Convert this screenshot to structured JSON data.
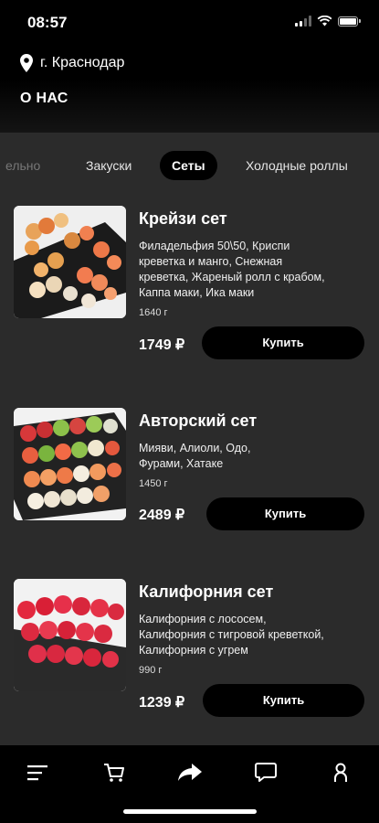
{
  "status": {
    "time": "08:57"
  },
  "header": {
    "city": "г. Краснодар",
    "about": "О НАС"
  },
  "tabs": [
    {
      "label": "ельно",
      "active": false
    },
    {
      "label": "Закуски",
      "active": false
    },
    {
      "label": "Сеты",
      "active": true
    },
    {
      "label": "Холодные роллы",
      "active": false
    }
  ],
  "products": [
    {
      "title": "Крейзи сет",
      "desc_lines": [
        "Филадельфия 50\\50, Криспи",
        "креветка и манго, Снежная",
        "креветка, Жареный ролл с крабом,",
        "Каппа маки, Ика маки"
      ],
      "weight": "1640 г",
      "price": "1749 ₽",
      "buy": "Купить"
    },
    {
      "title": "Авторский сет",
      "desc_lines": [
        "Мияви, Алиоли, Одо,",
        "Фурами, Хатаке"
      ],
      "weight": "1450 г",
      "price": "2489 ₽",
      "buy": "Купить"
    },
    {
      "title": "Калифорния сет",
      "desc_lines": [
        "Калифорния с лососем,",
        "Калифорния с тигровой креветкой,",
        "Калифорния с угрем"
      ],
      "weight": "990 г",
      "price": "1239 ₽",
      "buy": "Купить"
    }
  ],
  "nav": {
    "items": [
      "menu-icon",
      "cart-icon",
      "share-icon",
      "chat-icon",
      "profile-icon"
    ]
  },
  "colors": {
    "background": "#2b2b2b",
    "button": "#000000",
    "text": "#ffffff"
  }
}
